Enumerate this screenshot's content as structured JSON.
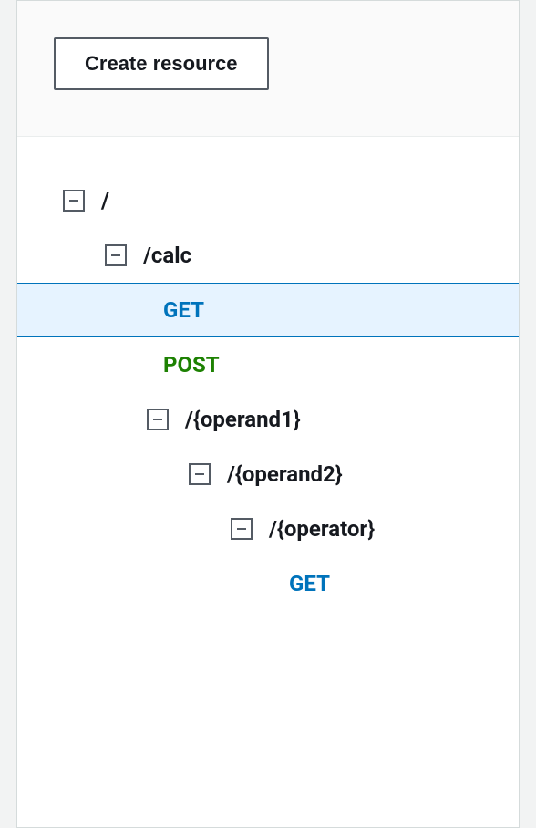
{
  "toolbar": {
    "create_label": "Create resource"
  },
  "tree": [
    {
      "indent": 0,
      "toggle": true,
      "label": "/",
      "kind": "resource",
      "selected": false,
      "name": "root"
    },
    {
      "indent": 1,
      "toggle": true,
      "label": "/calc",
      "kind": "resource",
      "selected": false,
      "name": "calc"
    },
    {
      "indent": 2,
      "toggle": false,
      "label": "GET",
      "kind": "method-get",
      "selected": true,
      "name": "calc-get"
    },
    {
      "indent": 2,
      "toggle": false,
      "label": "POST",
      "kind": "method-post",
      "selected": false,
      "name": "calc-post"
    },
    {
      "indent": 2,
      "toggle": true,
      "label": "/{operand1}",
      "kind": "resource",
      "selected": false,
      "name": "operand1"
    },
    {
      "indent": 3,
      "toggle": true,
      "label": "/{operand2}",
      "kind": "resource",
      "selected": false,
      "name": "operand2"
    },
    {
      "indent": 4,
      "toggle": true,
      "label": "/{operator}",
      "kind": "resource",
      "selected": false,
      "name": "operator"
    },
    {
      "indent": 5,
      "toggle": false,
      "label": "GET",
      "kind": "method-get",
      "selected": false,
      "name": "operator-get"
    }
  ]
}
